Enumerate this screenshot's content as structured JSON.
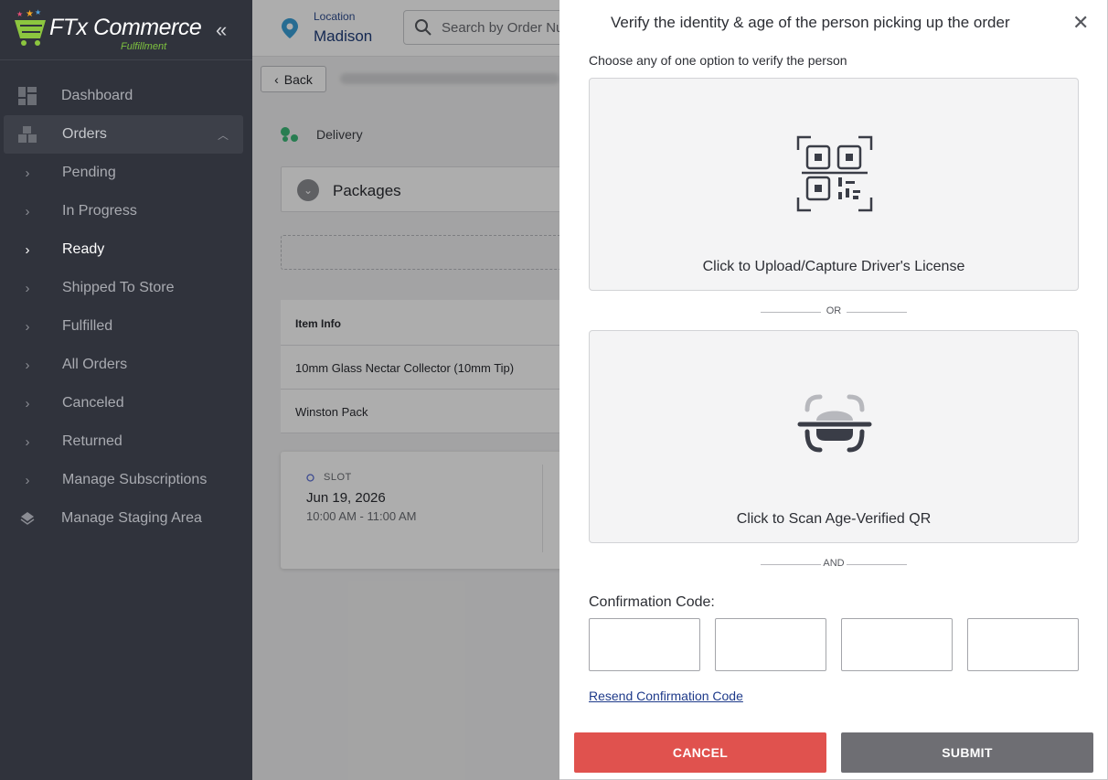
{
  "brand": {
    "name": "FTx Commerce",
    "sub": "Fulfillment"
  },
  "sidebar": {
    "items": [
      {
        "label": "Dashboard",
        "icon": "dashboard-icon"
      },
      {
        "label": "Orders",
        "icon": "orders-icon"
      },
      {
        "label": "Pending",
        "icon": "chevron-right-icon"
      },
      {
        "label": "In Progress",
        "icon": "chevron-right-icon"
      },
      {
        "label": "Ready",
        "icon": "chevron-right-icon"
      },
      {
        "label": "Shipped To Store",
        "icon": "chevron-right-icon"
      },
      {
        "label": "Fulfilled",
        "icon": "chevron-right-icon"
      },
      {
        "label": "All Orders",
        "icon": "chevron-right-icon"
      },
      {
        "label": "Canceled",
        "icon": "chevron-right-icon"
      },
      {
        "label": "Returned",
        "icon": "chevron-right-icon"
      },
      {
        "label": "Manage Subscriptions",
        "icon": "chevron-right-icon"
      },
      {
        "label": "Manage Staging Area",
        "icon": "staging-icon"
      }
    ]
  },
  "topbar": {
    "location_label": "Location",
    "location_value": "Madison",
    "search_placeholder": "Search by Order Number"
  },
  "order": {
    "back_label": "Back",
    "delivery_label": "Delivery",
    "packages_label": "Packages",
    "items_header": "Item Info",
    "items": [
      "10mm Glass Nectar Collector (10mm Tip)",
      "Winston Pack"
    ],
    "slot_label": "SLOT",
    "slot_date": "Jun 19, 2026",
    "slot_time": "10:00 AM - 11:00 AM"
  },
  "modal": {
    "title": "Verify the identity & age of the person picking up the order",
    "subtitle": "Choose any of one option to verify the person",
    "option1_label": "Click to Upload/Capture Driver's License",
    "or_label": "OR",
    "option2_label": "Click to Scan Age-Verified QR",
    "and_label": "AND",
    "code_label": "Confirmation Code:",
    "code_values": [
      "",
      "",
      "",
      ""
    ],
    "resend_label": "Resend Confirmation Code",
    "cancel_label": "CANCEL",
    "submit_label": "SUBMIT"
  },
  "colors": {
    "sidebar_bg": "#30333c",
    "cancel": "#e0524e",
    "submit": "#6e6e73",
    "link": "#1e3a8a",
    "brand_green": "#7ec23f"
  }
}
